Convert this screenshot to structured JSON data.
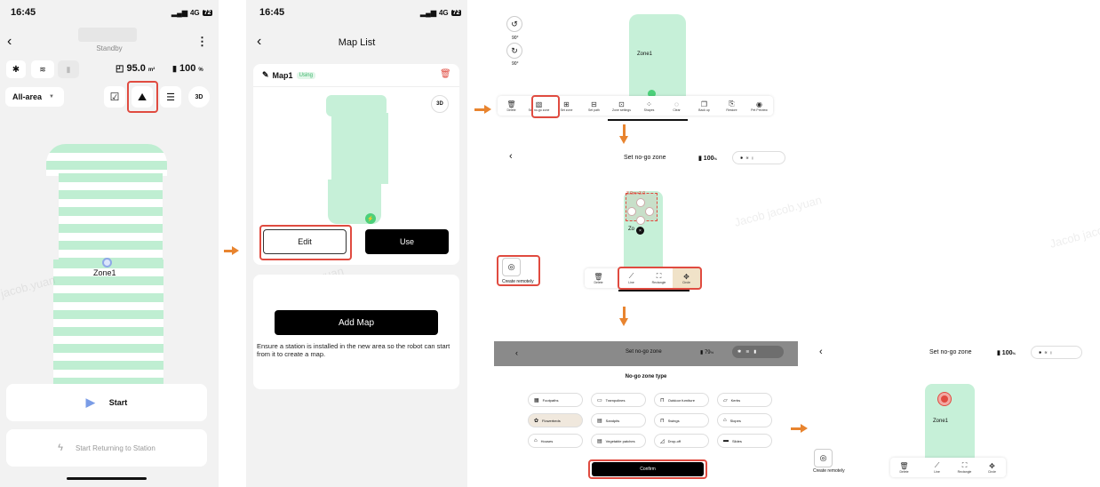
{
  "panel1": {
    "status_time": "16:45",
    "status_signal": "4G",
    "status_battery": "72",
    "title": "Standby",
    "stat_area": "95.0",
    "stat_area_unit": "m²",
    "stat_battery": "100",
    "stat_battery_unit": "%",
    "area_select": "All-area",
    "map_label": "Zone1",
    "start_label": "Start",
    "return_label": "Start Returning to Station",
    "watermark": "jacob.yuan"
  },
  "panel2": {
    "status_time": "16:45",
    "status_signal": "4G",
    "status_battery": "72",
    "title": "Map List",
    "map_name": "Map1",
    "using_badge": "Using",
    "view_3d": "3D",
    "edit_label": "Edit",
    "use_label": "Use",
    "add_map_label": "Add Map",
    "add_map_note": "Ensure a station is installed in the new area so the robot can start from it to create a map.",
    "watermark": "Jacob jacob.yuan"
  },
  "panel3": {
    "rotate_label_1": "90°",
    "rotate_label_2": "90°",
    "zone_label": "Zone1",
    "toolbar": [
      "Delete",
      "Set no-go zone",
      "Set zone",
      "Set path",
      "Zone settings",
      "Shapes",
      "Clear",
      "Back up",
      "Restore",
      "Pet Preview"
    ]
  },
  "panel4": {
    "title": "Set no-go zone",
    "battery": "100",
    "battery_unit": "%",
    "dimension_label": "3.0m×3.0",
    "zone_label": "Zo",
    "create_remotely": "Create remotely",
    "toolbar": [
      "Delete",
      "Line",
      "Rectangle",
      "Circle"
    ],
    "watermark": "Jacob jacob.yuan"
  },
  "panel5": {
    "title": "Set no-go zone",
    "battery": "79",
    "battery_unit": "%",
    "sheet_title": "No-go zone type",
    "types": [
      "Footpaths",
      "Trampolines",
      "Outdoor furniture",
      "Kerbs",
      "Flowerbeds",
      "Sandpits",
      "Swings",
      "Slopes",
      "Houses",
      "Vegetable patches",
      "Drop-off",
      "Slides"
    ],
    "confirm_label": "Confirm"
  },
  "panel6": {
    "title": "Set no-go zone",
    "battery": "100",
    "battery_unit": "%",
    "zone_label": "Zone1",
    "create_remotely": "Create remotely",
    "toolbar": [
      "Delete",
      "Line",
      "Rectangle",
      "Circle"
    ],
    "watermark": "Jacob jacob.yuan"
  },
  "colors": {
    "accent_red": "#e04b40",
    "arrow_orange": "#e8842f",
    "map_green": "#c6f0d8",
    "black": "#000000"
  }
}
